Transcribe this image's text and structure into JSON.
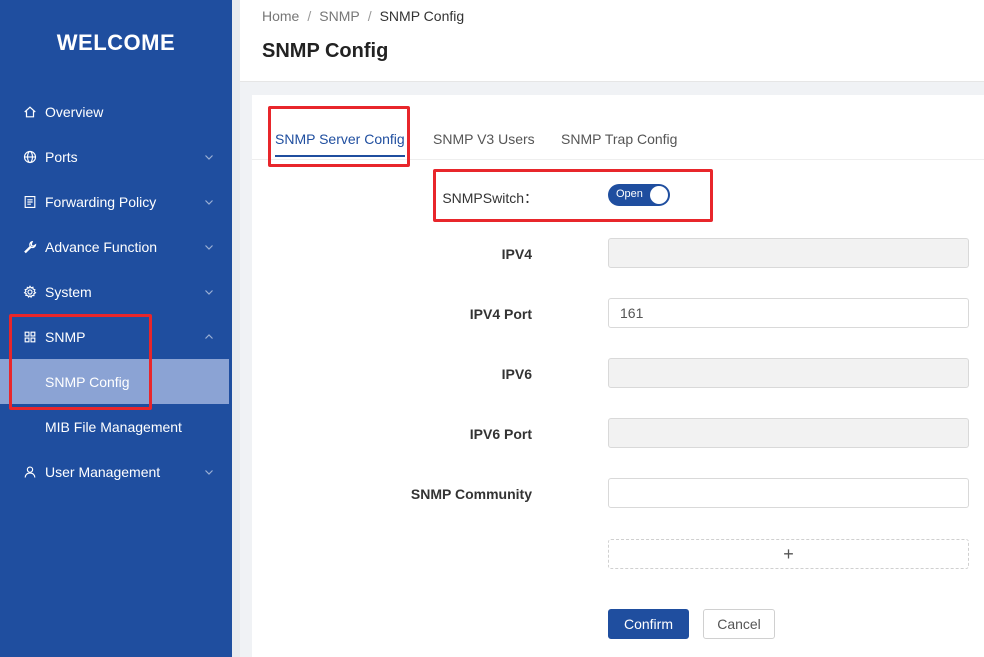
{
  "sidebar": {
    "title": "WELCOME",
    "items": [
      {
        "label": "Overview",
        "icon": "home-icon"
      },
      {
        "label": "Ports",
        "icon": "globe-icon"
      },
      {
        "label": "Forwarding Policy",
        "icon": "document-icon"
      },
      {
        "label": "Advance Function",
        "icon": "wrench-icon"
      },
      {
        "label": "System",
        "icon": "gear-icon"
      },
      {
        "label": "SNMP",
        "icon": "grid-icon"
      },
      {
        "label": "User Management",
        "icon": "user-icon"
      }
    ],
    "snmp_subitems": [
      {
        "label": "SNMP Config",
        "active": true
      },
      {
        "label": "MIB File Management",
        "active": false
      }
    ]
  },
  "breadcrumb": {
    "items": [
      "Home",
      "SNMP",
      "SNMP Config"
    ],
    "separator": "/"
  },
  "page": {
    "title": "SNMP Config"
  },
  "tabs": [
    {
      "label": "SNMP Server Config",
      "active": true
    },
    {
      "label": "SNMP V3 Users",
      "active": false
    },
    {
      "label": "SNMP Trap Config",
      "active": false
    }
  ],
  "form": {
    "switch_label": "SNMPSwitch：",
    "switch_text": "Open",
    "fields": [
      {
        "label": "IPV4",
        "value": "",
        "disabled": true
      },
      {
        "label": "IPV4 Port",
        "value": "161",
        "disabled": false
      },
      {
        "label": "IPV6",
        "value": "",
        "disabled": true
      },
      {
        "label": "IPV6 Port",
        "value": "",
        "disabled": true
      },
      {
        "label": "SNMP Community",
        "value": "",
        "disabled": false
      }
    ],
    "add_symbol": "+",
    "confirm_label": "Confirm",
    "cancel_label": "Cancel"
  },
  "colors": {
    "primary": "#1f4e9f",
    "sidebar_active": "#8ba3d4",
    "highlight": "#e8262b"
  }
}
